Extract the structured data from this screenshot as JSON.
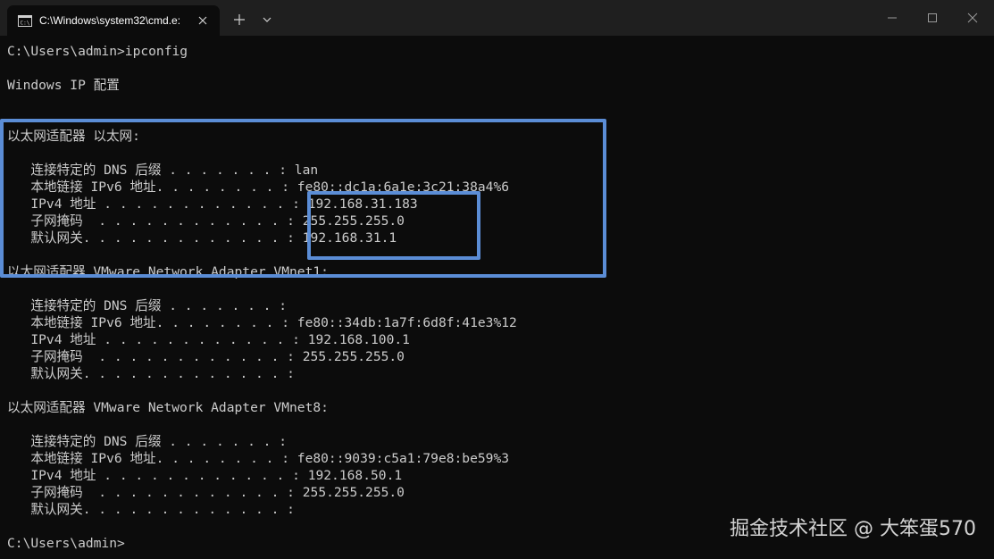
{
  "window": {
    "tab_title": "C:\\Windows\\system32\\cmd.e:",
    "tab_icon": "cmd-icon",
    "controls": [
      "new-tab-icon",
      "chevron-down-icon",
      "minimize-icon",
      "maximize-icon",
      "close-icon"
    ]
  },
  "terminal": {
    "lines": [
      "C:\\Users\\admin>ipconfig",
      "",
      "Windows IP 配置",
      "",
      "",
      "以太网适配器 以太网:",
      "",
      "   连接特定的 DNS 后缀 . . . . . . . : lan",
      "   本地链接 IPv6 地址. . . . . . . . : fe80::dc1a:6a1e:3c21:38a4%6",
      "   IPv4 地址 . . . . . . . . . . . . : 192.168.31.183",
      "   子网掩码  . . . . . . . . . . . . : 255.255.255.0",
      "   默认网关. . . . . . . . . . . . . : 192.168.31.1",
      "",
      "以太网适配器 VMware Network Adapter VMnet1:",
      "",
      "   连接特定的 DNS 后缀 . . . . . . . :",
      "   本地链接 IPv6 地址. . . . . . . . : fe80::34db:1a7f:6d8f:41e3%12",
      "   IPv4 地址 . . . . . . . . . . . . : 192.168.100.1",
      "   子网掩码  . . . . . . . . . . . . : 255.255.255.0",
      "   默认网关. . . . . . . . . . . . . :",
      "",
      "以太网适配器 VMware Network Adapter VMnet8:",
      "",
      "   连接特定的 DNS 后缀 . . . . . . . :",
      "   本地链接 IPv6 地址. . . . . . . . : fe80::9039:c5a1:79e8:be59%3",
      "   IPv4 地址 . . . . . . . . . . . . : 192.168.50.1",
      "   子网掩码  . . . . . . . . . . . . : 255.255.255.0",
      "   默认网关. . . . . . . . . . . . . :",
      "",
      "C:\\Users\\admin>"
    ]
  },
  "colors": {
    "background": "#0c0c0c",
    "titlebar": "#1f1f1f",
    "text": "#cccccc",
    "highlight": "#5b8dd6"
  },
  "watermark": "掘金技术社区 @ 大笨蛋570"
}
